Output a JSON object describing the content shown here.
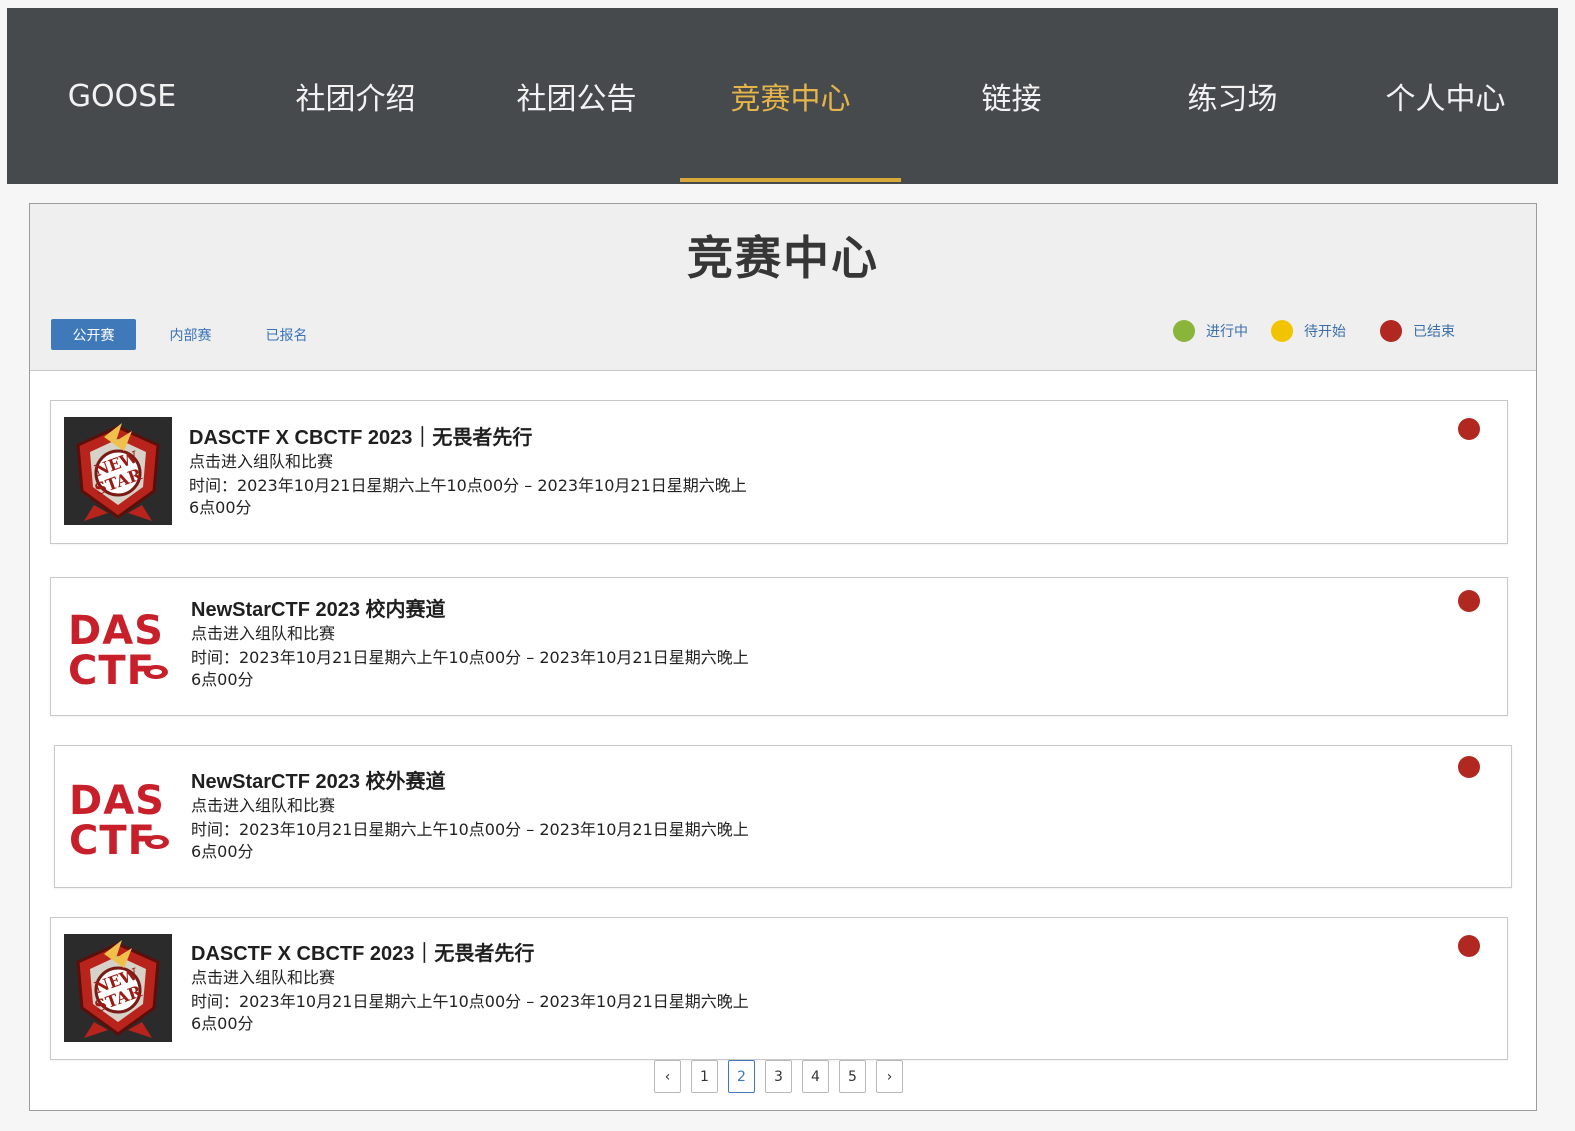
{
  "nav": {
    "brand": "GOOSE",
    "items": [
      "社团介绍",
      "社团公告",
      "竞赛中心",
      "链接",
      "练习场",
      "个人中心"
    ],
    "active_index": 2
  },
  "page": {
    "title": "竞赛中心",
    "tabs": [
      "公开赛",
      "内部赛",
      "已报名"
    ],
    "active_tab": 0,
    "legend": [
      {
        "label": "进行中",
        "color": "#8ab43a"
      },
      {
        "label": "待开始",
        "color": "#f2c400"
      },
      {
        "label": "已结束",
        "color": "#b0281f"
      }
    ]
  },
  "competitions": [
    {
      "logo": "newstar-logo",
      "title": "DASCTF X CBCTF 2023｜无畏者先行",
      "subtitle": "点击进入组队和比赛",
      "time": "时间：2023年10月21日星期六上午10点00分 – 2023年10月21日星期六晚上6点00分",
      "status": "已结束",
      "status_color": "#b0281f"
    },
    {
      "logo": "dasctf-logo",
      "title": "NewStarCTF 2023 校内赛道",
      "subtitle": "点击进入组队和比赛",
      "time": "时间：2023年10月21日星期六上午10点00分 – 2023年10月21日星期六晚上6点00分",
      "status": "已结束",
      "status_color": "#b0281f"
    },
    {
      "logo": "dasctf-logo",
      "title": "NewStarCTF 2023 校外赛道",
      "subtitle": "点击进入组队和比赛",
      "time": "时间：2023年10月21日星期六上午10点00分 – 2023年10月21日星期六晚上6点00分",
      "status": "已结束",
      "status_color": "#b0281f"
    },
    {
      "logo": "newstar-logo",
      "title": "DASCTF X CBCTF 2023｜无畏者先行",
      "subtitle": "点击进入组队和比赛",
      "time": "时间：2023年10月21日星期六上午10点00分 – 2023年10月21日星期六晚上6点00分",
      "status": "已结束",
      "status_color": "#b0281f"
    }
  ],
  "pagination": {
    "prev": "‹",
    "pages": [
      "1",
      "2",
      "3",
      "4",
      "5"
    ],
    "current": "2",
    "next": "›"
  }
}
